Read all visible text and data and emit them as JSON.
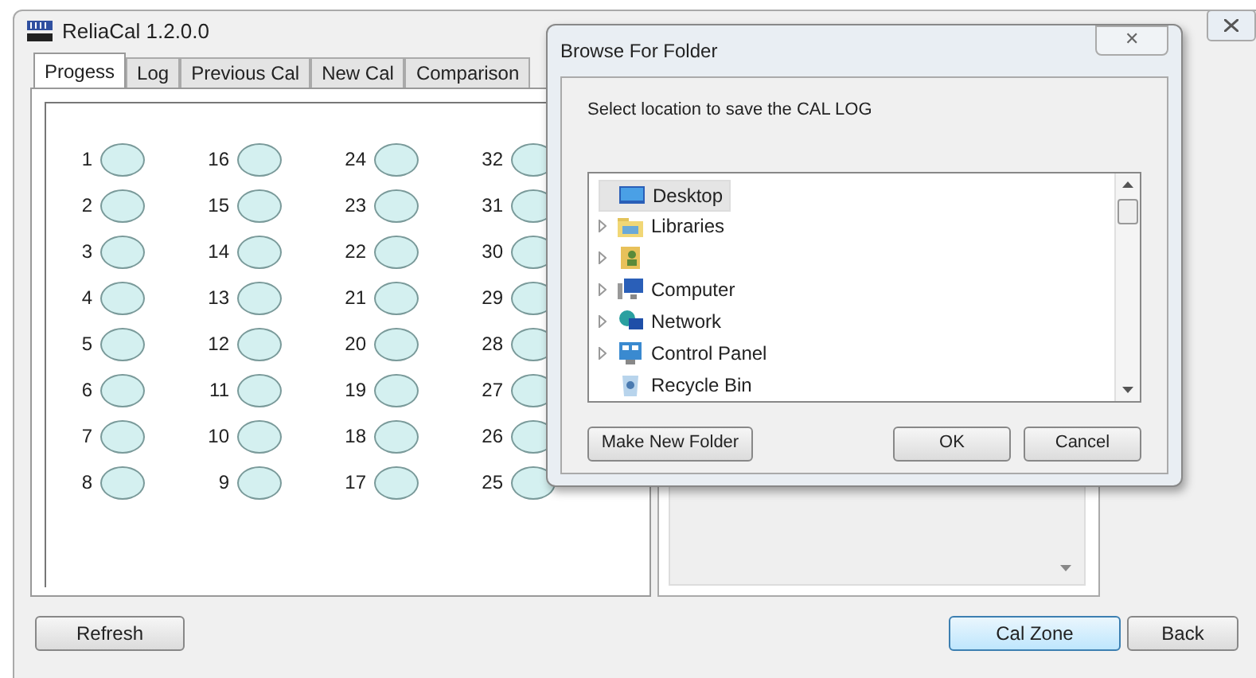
{
  "window": {
    "title": "ReliaCal 1.2.0.0"
  },
  "tabs": [
    {
      "label": "Progess",
      "selected": true
    },
    {
      "label": "Log",
      "selected": false
    },
    {
      "label": "Previous Cal",
      "selected": false
    },
    {
      "label": "New Cal",
      "selected": false
    },
    {
      "label": "Comparison",
      "selected": false
    }
  ],
  "slot_columns": [
    [
      "1",
      "2",
      "3",
      "4",
      "5",
      "6",
      "7",
      "8"
    ],
    [
      "16",
      "15",
      "14",
      "13",
      "12",
      "11",
      "10",
      "9"
    ],
    [
      "24",
      "23",
      "22",
      "21",
      "20",
      "19",
      "18",
      "17"
    ],
    [
      "32",
      "31",
      "30",
      "29",
      "28",
      "27",
      "26",
      "25"
    ]
  ],
  "buttons": {
    "refresh": "Refresh",
    "cal_zone": "Cal Zone",
    "back": "Back"
  },
  "dialog": {
    "title": "Browse For Folder",
    "close": "✕",
    "prompt": "Select location to save the CAL LOG",
    "tree": [
      {
        "kind": "desktop",
        "label": "Desktop",
        "expandable": false,
        "selected": true
      },
      {
        "kind": "libraries",
        "label": "Libraries",
        "expandable": true,
        "selected": false
      },
      {
        "kind": "user",
        "expandable": true,
        "selected": false
      },
      {
        "kind": "computer",
        "label": "Computer",
        "expandable": true,
        "selected": false
      },
      {
        "kind": "network",
        "label": "Network",
        "expandable": true,
        "selected": false
      },
      {
        "kind": "control-panel",
        "label": "Control Panel",
        "expandable": true,
        "selected": false
      },
      {
        "kind": "recycle-bin",
        "label": "Recycle Bin",
        "expandable": false,
        "selected": false
      }
    ],
    "make_folder": "Make New Folder",
    "ok": "OK",
    "cancel": "Cancel"
  }
}
